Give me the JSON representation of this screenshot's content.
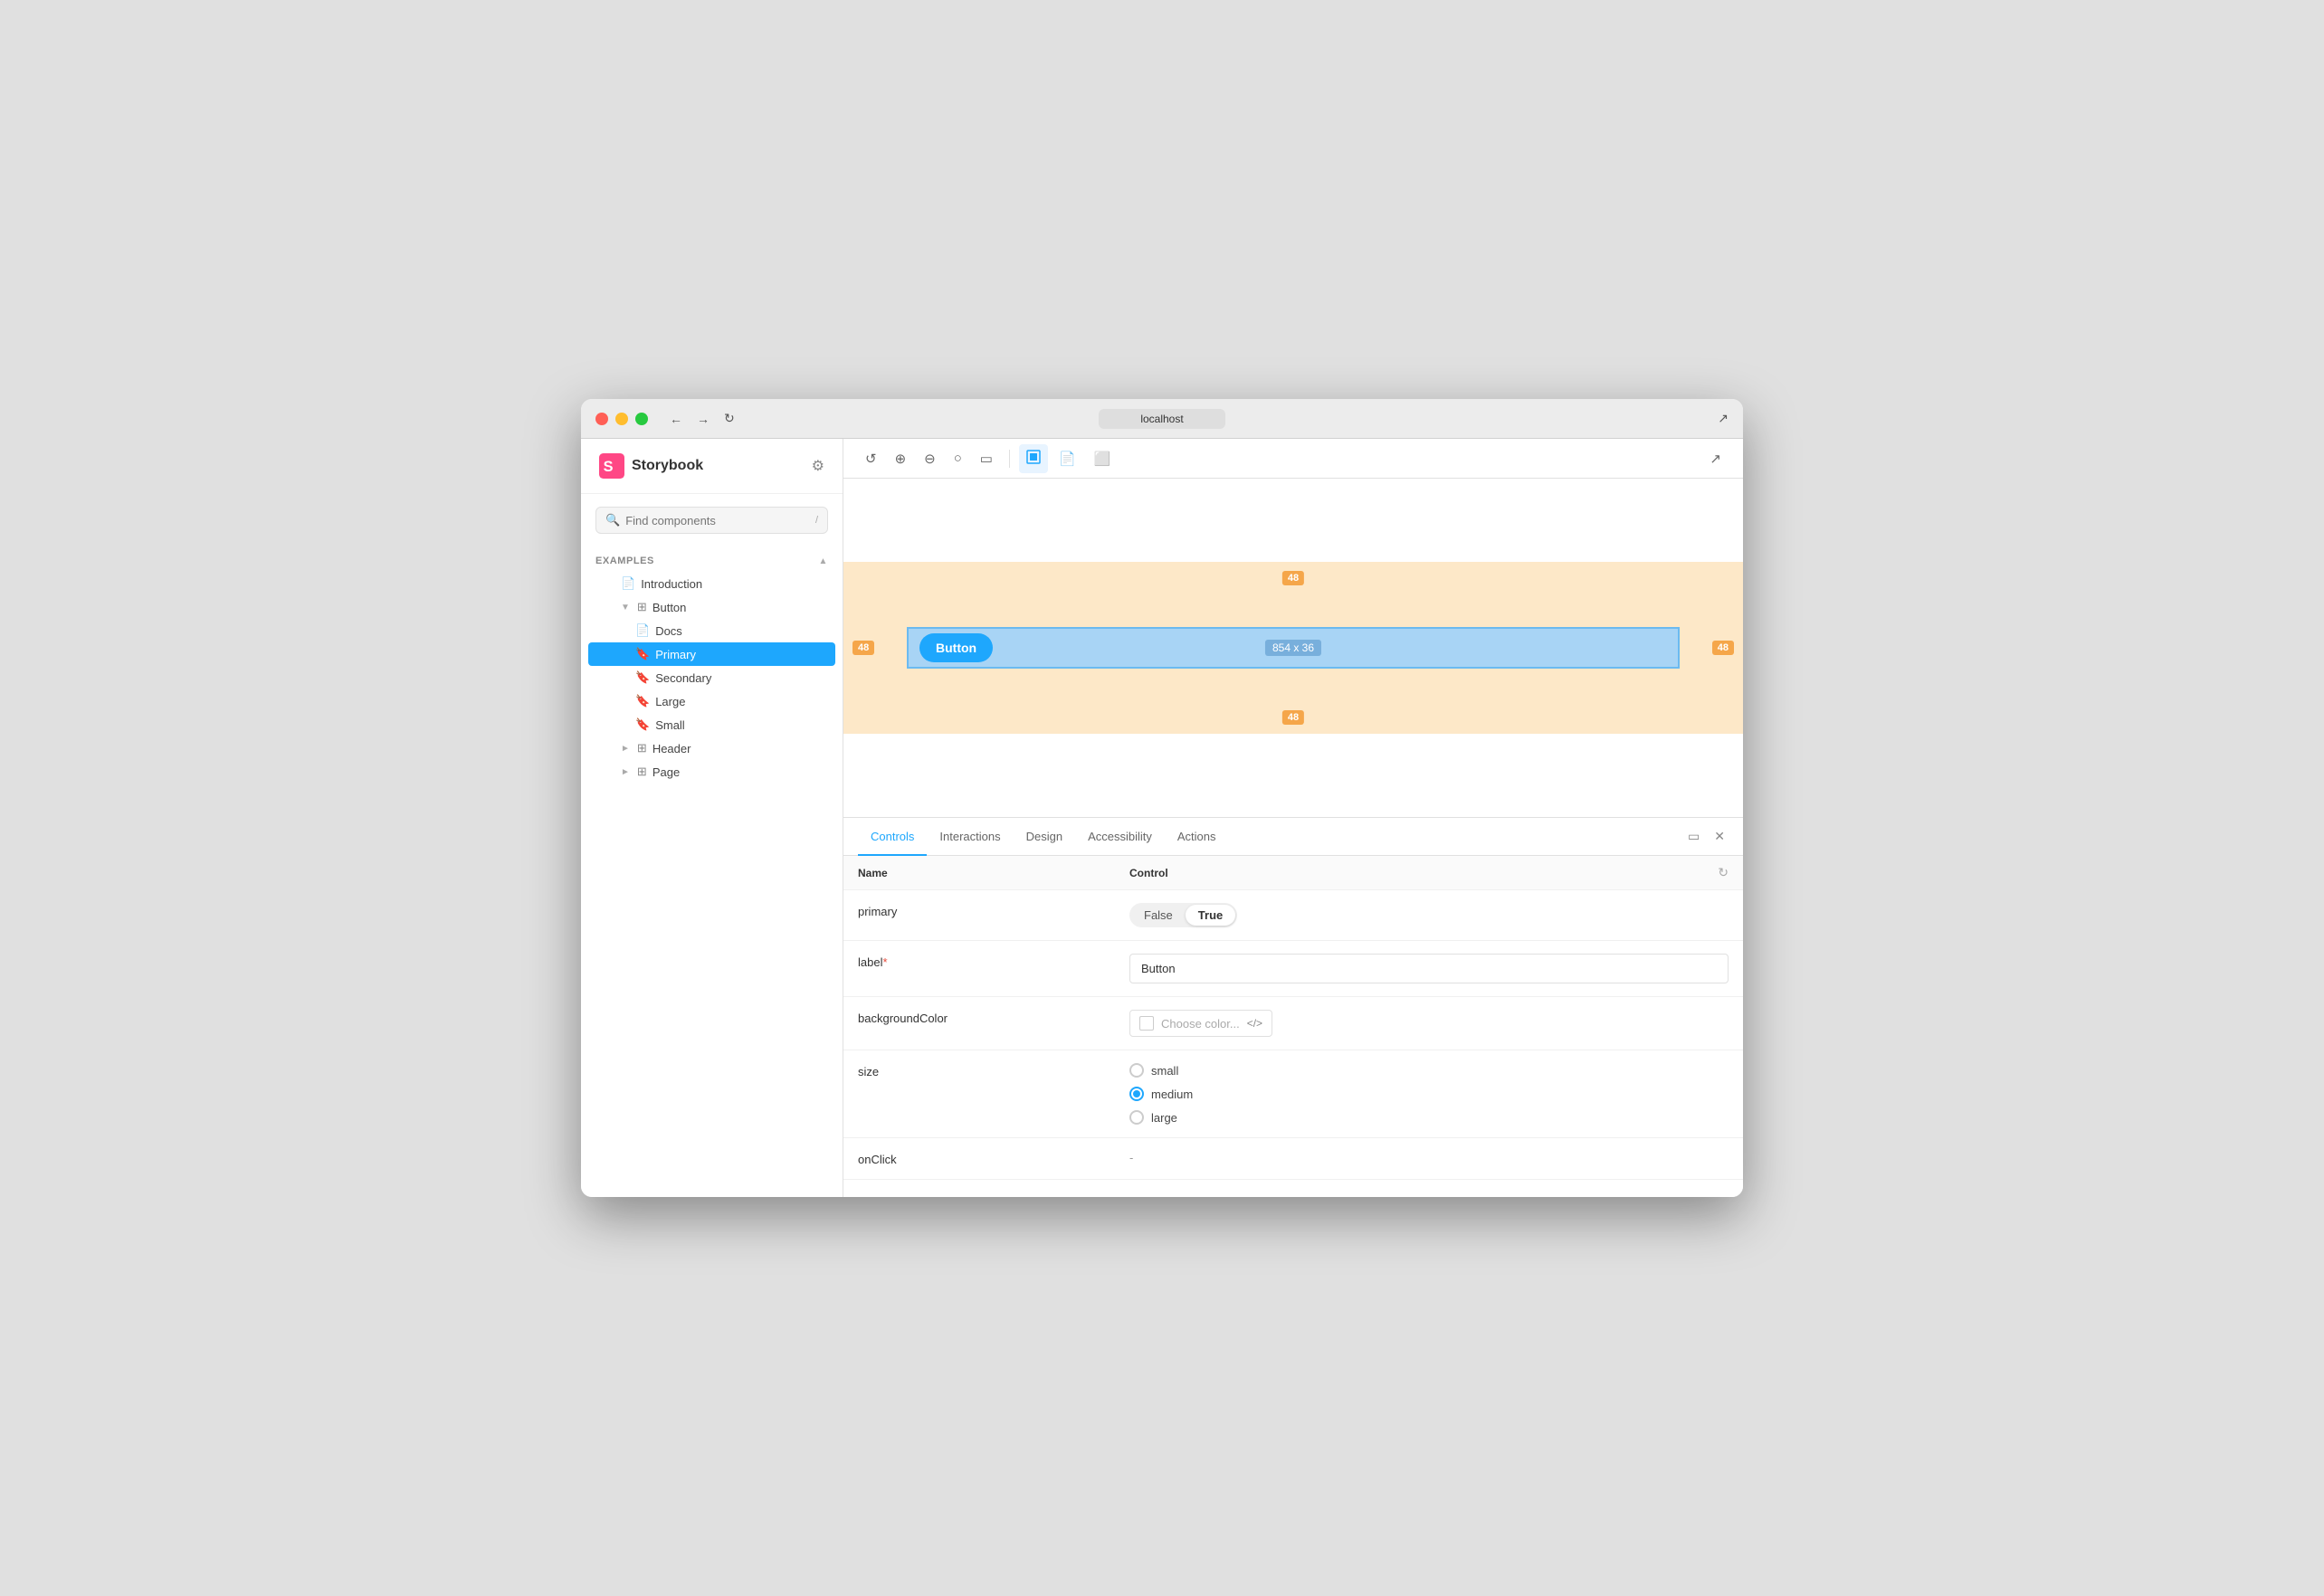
{
  "window": {
    "title": "localhost"
  },
  "sidebar": {
    "logo": "Storybook",
    "search_placeholder": "Find components",
    "search_shortcut": "/",
    "section_label": "EXAMPLES",
    "items": [
      {
        "id": "introduction",
        "label": "Introduction",
        "level": 2,
        "icon": "📄",
        "type": "doc"
      },
      {
        "id": "button",
        "label": "Button",
        "level": 2,
        "icon": "⊞",
        "type": "component",
        "expanded": true
      },
      {
        "id": "docs",
        "label": "Docs",
        "level": 3,
        "icon": "📄",
        "type": "doc"
      },
      {
        "id": "primary",
        "label": "Primary",
        "level": 3,
        "icon": "🔖",
        "type": "story",
        "active": true
      },
      {
        "id": "secondary",
        "label": "Secondary",
        "level": 3,
        "icon": "🔖",
        "type": "story"
      },
      {
        "id": "large",
        "label": "Large",
        "level": 3,
        "icon": "🔖",
        "type": "story"
      },
      {
        "id": "small",
        "label": "Small",
        "level": 3,
        "icon": "🔖",
        "type": "story"
      },
      {
        "id": "header",
        "label": "Header",
        "level": 2,
        "icon": "⊞",
        "type": "component",
        "expanded": false
      },
      {
        "id": "page",
        "label": "Page",
        "level": 2,
        "icon": "⊞",
        "type": "component",
        "expanded": false
      }
    ]
  },
  "toolbar": {
    "buttons": [
      {
        "id": "remount",
        "icon": "↺",
        "label": "Remount"
      },
      {
        "id": "zoom-in",
        "icon": "⊕",
        "label": "Zoom in"
      },
      {
        "id": "zoom-out",
        "icon": "⊖",
        "label": "Zoom out"
      },
      {
        "id": "zoom-reset",
        "icon": "⊙",
        "label": "Zoom reset"
      },
      {
        "id": "fullscreen",
        "icon": "⛶",
        "label": "Fullscreen"
      }
    ],
    "view_buttons": [
      {
        "id": "canvas",
        "icon": "▣",
        "label": "Canvas",
        "active": true
      },
      {
        "id": "docs",
        "icon": "📄",
        "label": "Docs"
      },
      {
        "id": "responsive",
        "icon": "⬚",
        "label": "Responsive"
      }
    ],
    "external_icon": "↗"
  },
  "canvas": {
    "margin_top": "48",
    "margin_bottom": "48",
    "margin_left": "48",
    "margin_right": "48",
    "size_label": "854 x 36",
    "button_label": "Button"
  },
  "panel": {
    "tabs": [
      {
        "id": "controls",
        "label": "Controls",
        "active": true
      },
      {
        "id": "interactions",
        "label": "Interactions"
      },
      {
        "id": "design",
        "label": "Design"
      },
      {
        "id": "accessibility",
        "label": "Accessibility"
      },
      {
        "id": "actions",
        "label": "Actions"
      }
    ],
    "controls_header": {
      "name_col": "Name",
      "control_col": "Control"
    },
    "controls": [
      {
        "id": "primary",
        "name": "primary",
        "required": false,
        "type": "toggle",
        "options": [
          "False",
          "True"
        ],
        "selected": "True"
      },
      {
        "id": "label",
        "name": "label",
        "required": true,
        "type": "text",
        "value": "Button"
      },
      {
        "id": "backgroundColor",
        "name": "backgroundColor",
        "required": false,
        "type": "color",
        "placeholder": "Choose color..."
      },
      {
        "id": "size",
        "name": "size",
        "required": false,
        "type": "radio",
        "options": [
          "small",
          "medium",
          "large"
        ],
        "selected": "medium"
      },
      {
        "id": "onClick",
        "name": "onClick",
        "required": false,
        "type": "dash",
        "value": "-"
      }
    ]
  }
}
